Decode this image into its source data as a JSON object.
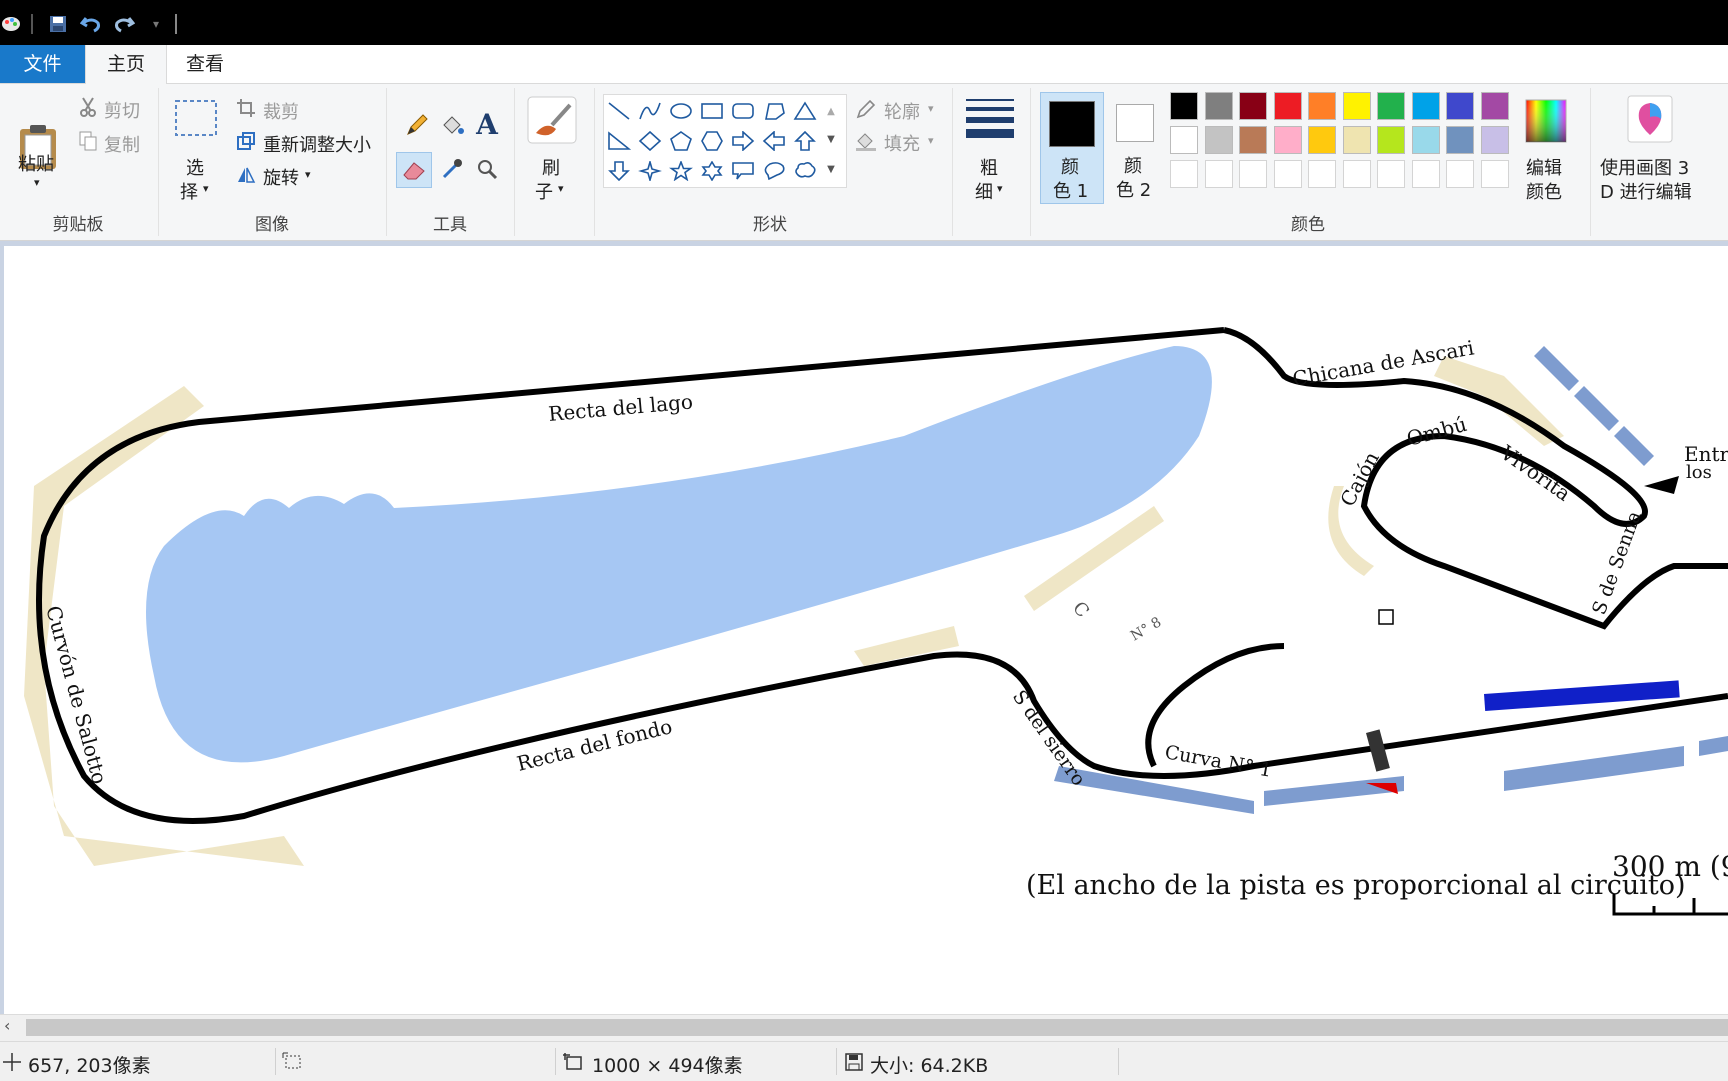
{
  "tabs": {
    "file": "文件",
    "home": "主页",
    "view": "查看"
  },
  "clipboard": {
    "paste": "粘贴",
    "cut": "剪切",
    "copy": "复制",
    "group": "剪贴板"
  },
  "image": {
    "select_line1": "选",
    "select_line2": "择",
    "crop": "裁剪",
    "resize": "重新调整大小",
    "rotate": "旋转",
    "group": "图像"
  },
  "tools": {
    "group": "工具"
  },
  "brush": {
    "line1": "刷",
    "line2": "子"
  },
  "shapes": {
    "outline": "轮廓",
    "fill": "填充",
    "group": "形状"
  },
  "size": {
    "line1": "粗",
    "line2": "细"
  },
  "colors": {
    "color1_line1": "颜",
    "color1_line2": "色 1",
    "color2_line1": "颜",
    "color2_line2": "色 2",
    "edit_line1": "编辑",
    "edit_line2": "颜色",
    "group": "颜色",
    "color1_value": "#000000",
    "color2_value": "#ffffff",
    "palette_row1": [
      "#000000",
      "#7f7f7f",
      "#880015",
      "#ed1c24",
      "#ff7f27",
      "#fff200",
      "#22b14c",
      "#00a2e8",
      "#3f48cc",
      "#a349a4"
    ],
    "palette_row2": [
      "#ffffff",
      "#c3c3c3",
      "#b97a57",
      "#ffaec9",
      "#ffc90e",
      "#efe4b0",
      "#b5e61d",
      "#99d9ea",
      "#7092be",
      "#c8bfe7"
    ]
  },
  "paint3d": {
    "line1": "使用画图 3",
    "line2": "D 进行编辑"
  },
  "canvas_labels": {
    "recta_lago": "Recta del lago",
    "recta_fondo": "Recta del fondo",
    "curvon": "Curvón de Salotto",
    "chicana": "Chicana de Ascari",
    "ombu": "Ombú",
    "vivorita": "Vivorita",
    "cajon": "Cajón",
    "entrada_1": "Entr",
    "entrada_2": "los",
    "senna": "S de Senna",
    "s_sierro": "S del sierro",
    "curva1": "Curva N° 1",
    "c_label": "C",
    "n8_label": "N° 8",
    "caption": "(El ancho de la pista es proporcional al circuito)",
    "scale": "300 m (9"
  },
  "status": {
    "coords": "657, 203像素",
    "dimensions": "1000 × 494像素",
    "size": "大小: 64.2KB"
  }
}
